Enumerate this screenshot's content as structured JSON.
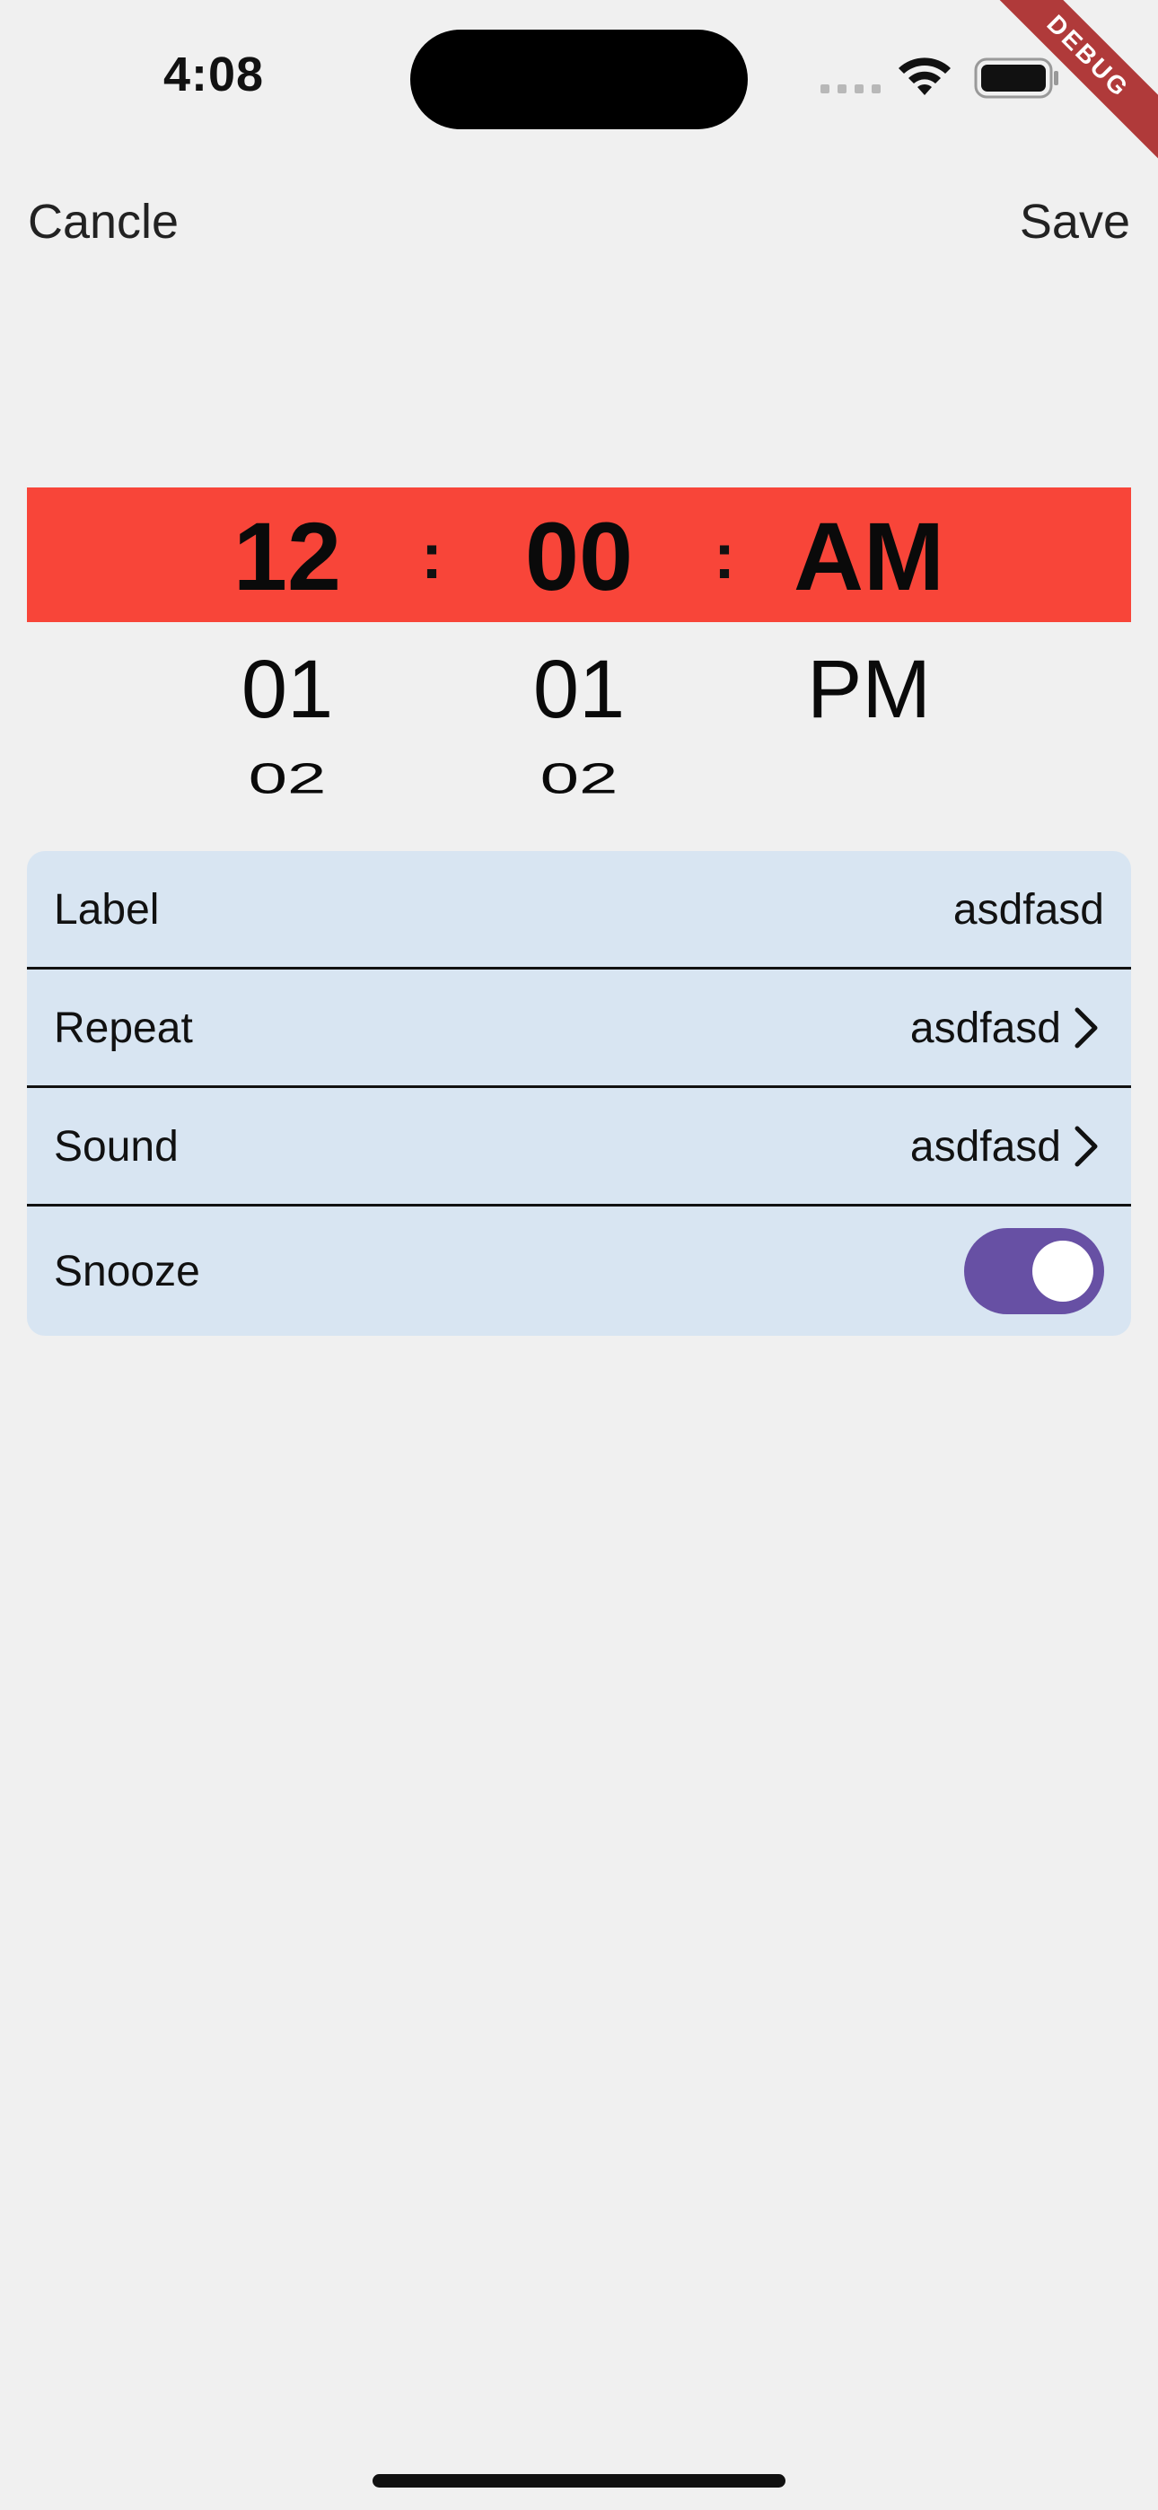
{
  "status_bar": {
    "time": "4:08"
  },
  "debug_banner": "DEBUG",
  "nav": {
    "cancel_label": "Cancle",
    "save_label": "Save"
  },
  "picker": {
    "hour": {
      "selected": "12",
      "next": "01",
      "after": "02"
    },
    "minute": {
      "selected": "00",
      "next": "01",
      "after": "02"
    },
    "period": {
      "selected": "AM",
      "next": "PM"
    },
    "separator": ":",
    "highlight_color": "#f84539"
  },
  "settings": {
    "label": {
      "title": "Label",
      "value": "asdfasd"
    },
    "repeat": {
      "title": "Repeat",
      "value": "asdfasd"
    },
    "sound": {
      "title": "Sound",
      "value": "asdfasd"
    },
    "snooze": {
      "title": "Snooze",
      "enabled": true,
      "toggle_color": "#6750a4"
    }
  }
}
